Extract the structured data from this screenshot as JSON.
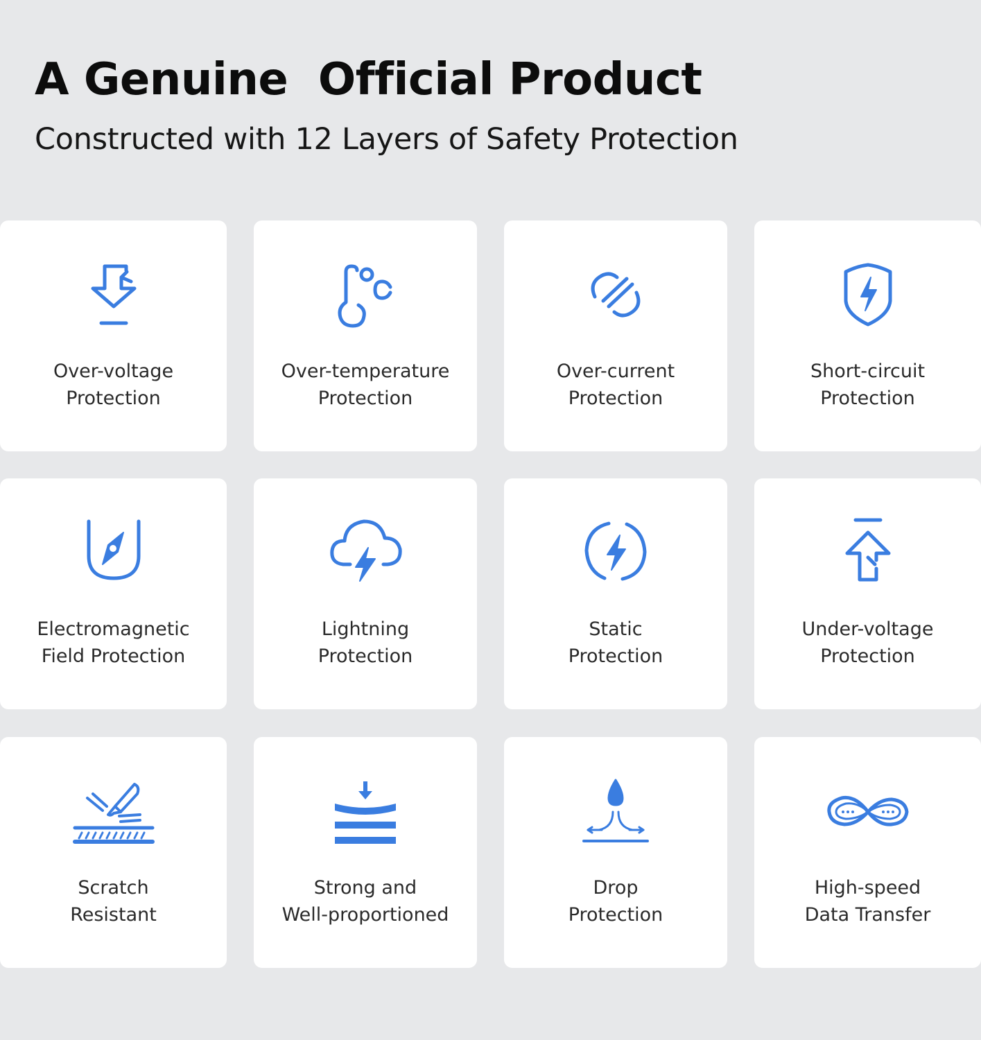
{
  "header": {
    "title": "A Genuine  Official Product",
    "subtitle": "Constructed with 12 Layers of Safety Protection"
  },
  "colors": {
    "background": "#e7e8ea",
    "card": "#ffffff",
    "accent": "#3a7de0",
    "text": "#2a2a2a"
  },
  "features": [
    {
      "icon": "over-voltage-arrow-down-icon",
      "line1": "Over-voltage",
      "line2": "Protection"
    },
    {
      "icon": "thermometer-celsius-icon",
      "line1": "Over-temperature",
      "line2": "Protection"
    },
    {
      "icon": "current-cut-icon",
      "line1": "Over-current",
      "line2": "Protection"
    },
    {
      "icon": "shield-bolt-icon",
      "line1": "Short-circuit",
      "line2": "Protection"
    },
    {
      "icon": "magnet-compass-icon",
      "line1": "Electromagnetic",
      "line2": "Field Protection"
    },
    {
      "icon": "cloud-lightning-icon",
      "line1": "Lightning",
      "line2": "Protection"
    },
    {
      "icon": "circle-bolt-icon",
      "line1": "Static",
      "line2": "Protection"
    },
    {
      "icon": "under-voltage-arrow-up-icon",
      "line1": "Under-voltage",
      "line2": "Protection"
    },
    {
      "icon": "scratch-blade-icon",
      "line1": "Scratch",
      "line2": "Resistant"
    },
    {
      "icon": "layers-press-icon",
      "line1": "Strong and",
      "line2": "Well-proportioned"
    },
    {
      "icon": "water-drop-icon",
      "line1": "Drop",
      "line2": "Protection"
    },
    {
      "icon": "infinity-data-icon",
      "line1": "High-speed",
      "line2": "Data Transfer"
    }
  ]
}
